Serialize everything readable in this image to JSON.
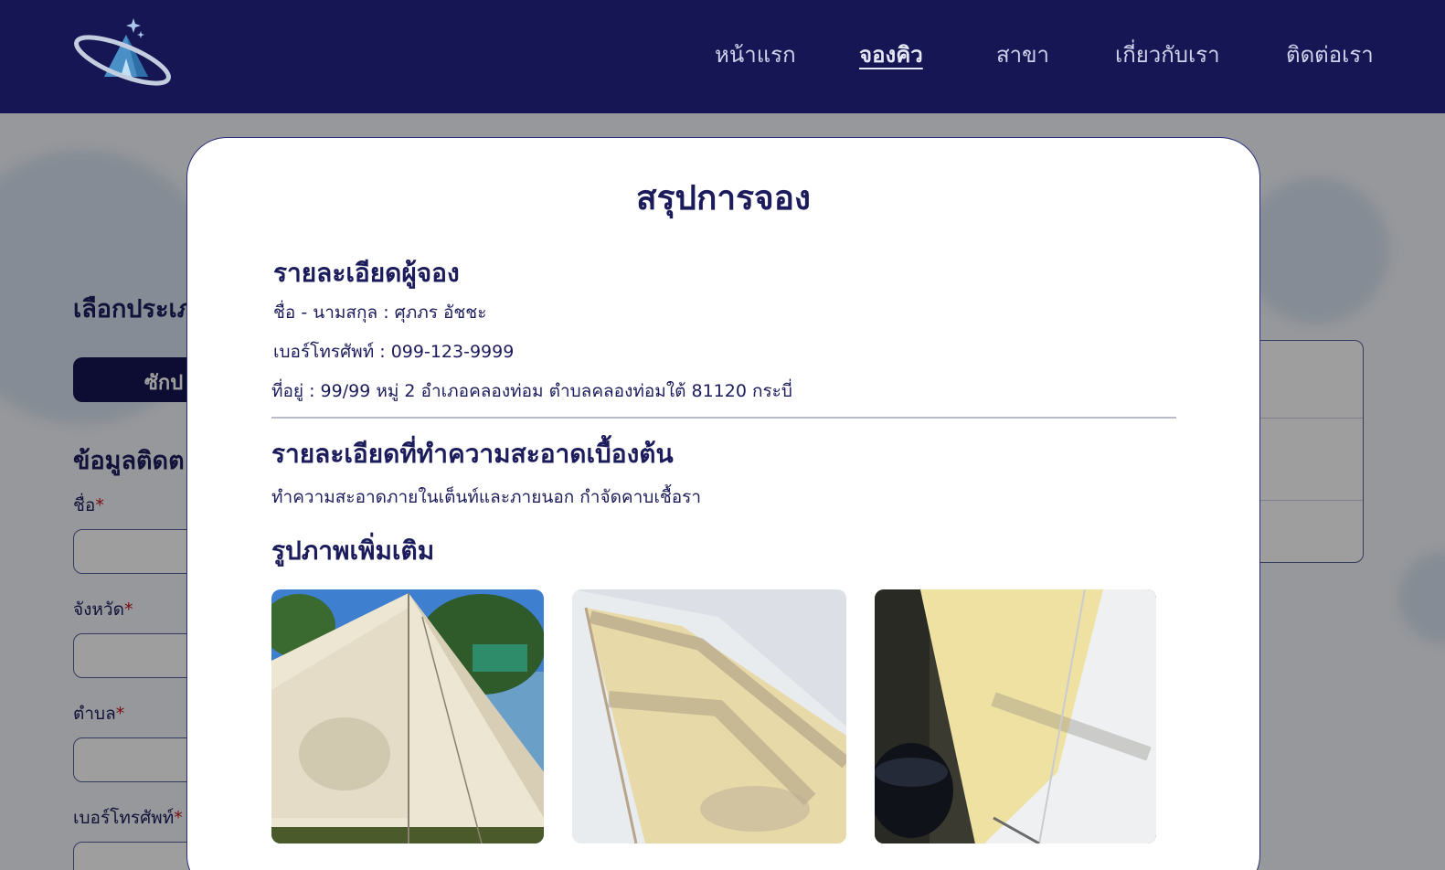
{
  "nav": {
    "items": [
      {
        "label": "หน้าแรก"
      },
      {
        "label": "จองคิว"
      },
      {
        "label": "สาขา"
      },
      {
        "label": "เกี่ยวกับเรา"
      },
      {
        "label": "ติดต่อเรา"
      }
    ],
    "active_index": 1
  },
  "background_form": {
    "section_title": "เลือกประเภ",
    "tab_label": "ซักป",
    "contact_title": "ข้อมูลติดต",
    "fields": [
      {
        "label": "ชื่อ",
        "required_mark": "*"
      },
      {
        "label": "จังหวัด",
        "required_mark": "*"
      },
      {
        "label": "ตำบล",
        "required_mark": "*"
      },
      {
        "label": "เบอร์โทรศัพท์",
        "required_mark": "*"
      }
    ]
  },
  "modal": {
    "title": "สรุปการจอง",
    "booker": {
      "heading": "รายละเอียดผู้จอง",
      "name_line": "ชื่อ - นามสกุล : ศุภภร อัชชะ",
      "phone_line": "เบอร์โทรศัพท์  : 099-123-9999",
      "address_line": "ที่อยู่ : 99/99 หมู่ 2 อำเภอคลองท่อม ตำบลคลองท่อมใต้ 81120 กระบี่"
    },
    "cleaning": {
      "heading": "รายละเอียดที่ทำความสะอาดเบื้องต้น",
      "detail": "ทำความสะอาดภายในเต็นท์และภายนอก กำจัดคาบเชื้อรา"
    },
    "photos": {
      "heading": "รูปภาพเพิ่มเติม",
      "count": 3
    }
  },
  "colors": {
    "navy": "#161654",
    "text": "#1c1c5c",
    "required": "#c0141e"
  }
}
